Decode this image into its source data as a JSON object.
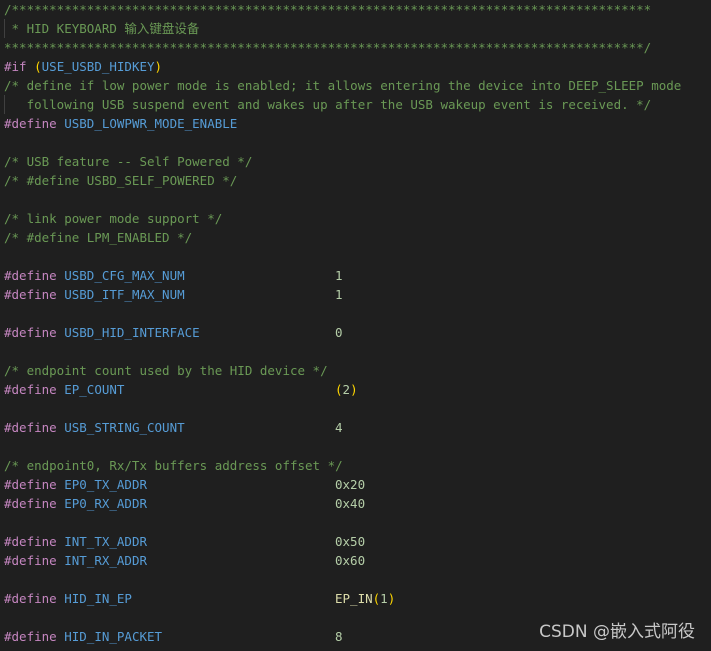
{
  "code": {
    "l1": "/*************************************************************************************",
    "l2": " * HID KEYBOARD 输入键盘设备",
    "l3": "*************************************************************************************/",
    "l4_kw": "#if",
    "l4_open": " (",
    "l4_name": "USE_USBD_HIDKEY",
    "l4_close": ")",
    "l5": "/* define if low power mode is enabled; it allows entering the device into DEEP_SLEEP mode",
    "l6": "   following USB suspend event and wakes up after the USB wakeup event is received. */",
    "l7_name": "USBD_LOWPWR_MODE_ENABLE",
    "l9": "/* USB feature -- Self Powered */",
    "l10": "/* #define USBD_SELF_POWERED */",
    "l12": "/* link power mode support */",
    "l13": "/* #define LPM_ENABLED */",
    "l15_name": "USBD_CFG_MAX_NUM",
    "l15_val": "1",
    "l16_name": "USBD_ITF_MAX_NUM",
    "l16_val": "1",
    "l18_name": "USBD_HID_INTERFACE",
    "l18_val": "0",
    "l20": "/* endpoint count used by the HID device */",
    "l21_name": "EP_COUNT",
    "l21_open": "(",
    "l21_val": "2",
    "l21_close": ")",
    "l23_name": "USB_STRING_COUNT",
    "l23_val": "4",
    "l25": "/* endpoint0, Rx/Tx buffers address offset */",
    "l26_name": "EP0_TX_ADDR",
    "l26_val": "0x20",
    "l27_name": "EP0_RX_ADDR",
    "l27_val": "0x40",
    "l29_name": "INT_TX_ADDR",
    "l29_val": "0x50",
    "l30_name": "INT_RX_ADDR",
    "l30_val": "0x60",
    "l32_name": "HID_IN_EP",
    "l32_fn": "EP_IN",
    "l32_open": "(",
    "l32_val": "1",
    "l32_close": ")",
    "l34_name": "HID_IN_PACKET",
    "l34_val": "8"
  },
  "keywords": {
    "define": "#define"
  },
  "watermark": "CSDN @嵌入式阿役",
  "colors": {
    "background": "#1f1f1f",
    "comment": "#6a9955",
    "preprocessor": "#c586c0",
    "macro": "#569cd6",
    "number": "#b5cea8",
    "bracket": "#ffd700",
    "function": "#dcdcaa"
  }
}
